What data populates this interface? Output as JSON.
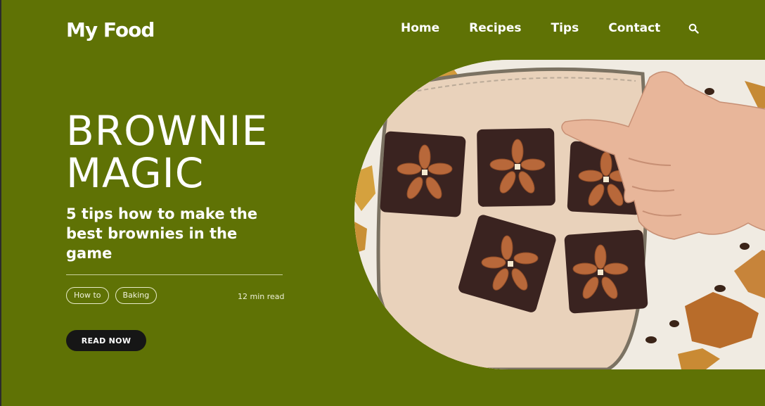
{
  "header": {
    "logo": "My Food",
    "nav": [
      {
        "label": "Home"
      },
      {
        "label": "Recipes"
      },
      {
        "label": "Tips"
      },
      {
        "label": "Contact"
      }
    ],
    "search_icon": "search-icon"
  },
  "hero": {
    "title_line1": "BROWNIE",
    "title_line2": "MAGIC",
    "subtitle": "5 tips how to make the best brownies in the game",
    "tags": [
      {
        "label": "How to"
      },
      {
        "label": "Baking"
      }
    ],
    "read_time": "12 min read",
    "cta_label": "READ NOW"
  },
  "colors": {
    "background": "#5f7205",
    "button": "#161616",
    "text": "#ffffff"
  }
}
